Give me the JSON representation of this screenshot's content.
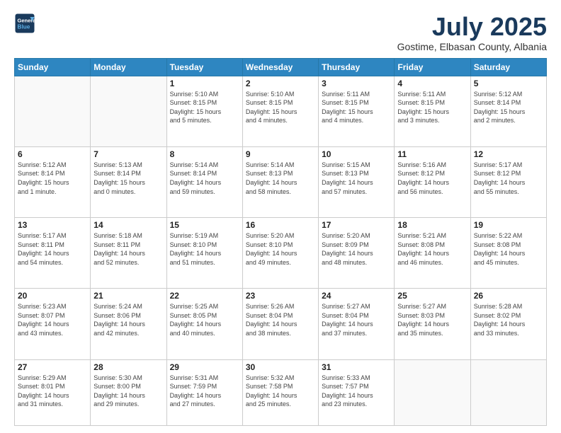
{
  "logo": {
    "line1": "General",
    "line2": "Blue"
  },
  "title": "July 2025",
  "subtitle": "Gostime, Elbasan County, Albania",
  "headers": [
    "Sunday",
    "Monday",
    "Tuesday",
    "Wednesday",
    "Thursday",
    "Friday",
    "Saturday"
  ],
  "weeks": [
    [
      {
        "day": "",
        "info": ""
      },
      {
        "day": "",
        "info": ""
      },
      {
        "day": "1",
        "info": "Sunrise: 5:10 AM\nSunset: 8:15 PM\nDaylight: 15 hours\nand 5 minutes."
      },
      {
        "day": "2",
        "info": "Sunrise: 5:10 AM\nSunset: 8:15 PM\nDaylight: 15 hours\nand 4 minutes."
      },
      {
        "day": "3",
        "info": "Sunrise: 5:11 AM\nSunset: 8:15 PM\nDaylight: 15 hours\nand 4 minutes."
      },
      {
        "day": "4",
        "info": "Sunrise: 5:11 AM\nSunset: 8:15 PM\nDaylight: 15 hours\nand 3 minutes."
      },
      {
        "day": "5",
        "info": "Sunrise: 5:12 AM\nSunset: 8:14 PM\nDaylight: 15 hours\nand 2 minutes."
      }
    ],
    [
      {
        "day": "6",
        "info": "Sunrise: 5:12 AM\nSunset: 8:14 PM\nDaylight: 15 hours\nand 1 minute."
      },
      {
        "day": "7",
        "info": "Sunrise: 5:13 AM\nSunset: 8:14 PM\nDaylight: 15 hours\nand 0 minutes."
      },
      {
        "day": "8",
        "info": "Sunrise: 5:14 AM\nSunset: 8:14 PM\nDaylight: 14 hours\nand 59 minutes."
      },
      {
        "day": "9",
        "info": "Sunrise: 5:14 AM\nSunset: 8:13 PM\nDaylight: 14 hours\nand 58 minutes."
      },
      {
        "day": "10",
        "info": "Sunrise: 5:15 AM\nSunset: 8:13 PM\nDaylight: 14 hours\nand 57 minutes."
      },
      {
        "day": "11",
        "info": "Sunrise: 5:16 AM\nSunset: 8:12 PM\nDaylight: 14 hours\nand 56 minutes."
      },
      {
        "day": "12",
        "info": "Sunrise: 5:17 AM\nSunset: 8:12 PM\nDaylight: 14 hours\nand 55 minutes."
      }
    ],
    [
      {
        "day": "13",
        "info": "Sunrise: 5:17 AM\nSunset: 8:11 PM\nDaylight: 14 hours\nand 54 minutes."
      },
      {
        "day": "14",
        "info": "Sunrise: 5:18 AM\nSunset: 8:11 PM\nDaylight: 14 hours\nand 52 minutes."
      },
      {
        "day": "15",
        "info": "Sunrise: 5:19 AM\nSunset: 8:10 PM\nDaylight: 14 hours\nand 51 minutes."
      },
      {
        "day": "16",
        "info": "Sunrise: 5:20 AM\nSunset: 8:10 PM\nDaylight: 14 hours\nand 49 minutes."
      },
      {
        "day": "17",
        "info": "Sunrise: 5:20 AM\nSunset: 8:09 PM\nDaylight: 14 hours\nand 48 minutes."
      },
      {
        "day": "18",
        "info": "Sunrise: 5:21 AM\nSunset: 8:08 PM\nDaylight: 14 hours\nand 46 minutes."
      },
      {
        "day": "19",
        "info": "Sunrise: 5:22 AM\nSunset: 8:08 PM\nDaylight: 14 hours\nand 45 minutes."
      }
    ],
    [
      {
        "day": "20",
        "info": "Sunrise: 5:23 AM\nSunset: 8:07 PM\nDaylight: 14 hours\nand 43 minutes."
      },
      {
        "day": "21",
        "info": "Sunrise: 5:24 AM\nSunset: 8:06 PM\nDaylight: 14 hours\nand 42 minutes."
      },
      {
        "day": "22",
        "info": "Sunrise: 5:25 AM\nSunset: 8:05 PM\nDaylight: 14 hours\nand 40 minutes."
      },
      {
        "day": "23",
        "info": "Sunrise: 5:26 AM\nSunset: 8:04 PM\nDaylight: 14 hours\nand 38 minutes."
      },
      {
        "day": "24",
        "info": "Sunrise: 5:27 AM\nSunset: 8:04 PM\nDaylight: 14 hours\nand 37 minutes."
      },
      {
        "day": "25",
        "info": "Sunrise: 5:27 AM\nSunset: 8:03 PM\nDaylight: 14 hours\nand 35 minutes."
      },
      {
        "day": "26",
        "info": "Sunrise: 5:28 AM\nSunset: 8:02 PM\nDaylight: 14 hours\nand 33 minutes."
      }
    ],
    [
      {
        "day": "27",
        "info": "Sunrise: 5:29 AM\nSunset: 8:01 PM\nDaylight: 14 hours\nand 31 minutes."
      },
      {
        "day": "28",
        "info": "Sunrise: 5:30 AM\nSunset: 8:00 PM\nDaylight: 14 hours\nand 29 minutes."
      },
      {
        "day": "29",
        "info": "Sunrise: 5:31 AM\nSunset: 7:59 PM\nDaylight: 14 hours\nand 27 minutes."
      },
      {
        "day": "30",
        "info": "Sunrise: 5:32 AM\nSunset: 7:58 PM\nDaylight: 14 hours\nand 25 minutes."
      },
      {
        "day": "31",
        "info": "Sunrise: 5:33 AM\nSunset: 7:57 PM\nDaylight: 14 hours\nand 23 minutes."
      },
      {
        "day": "",
        "info": ""
      },
      {
        "day": "",
        "info": ""
      }
    ]
  ]
}
